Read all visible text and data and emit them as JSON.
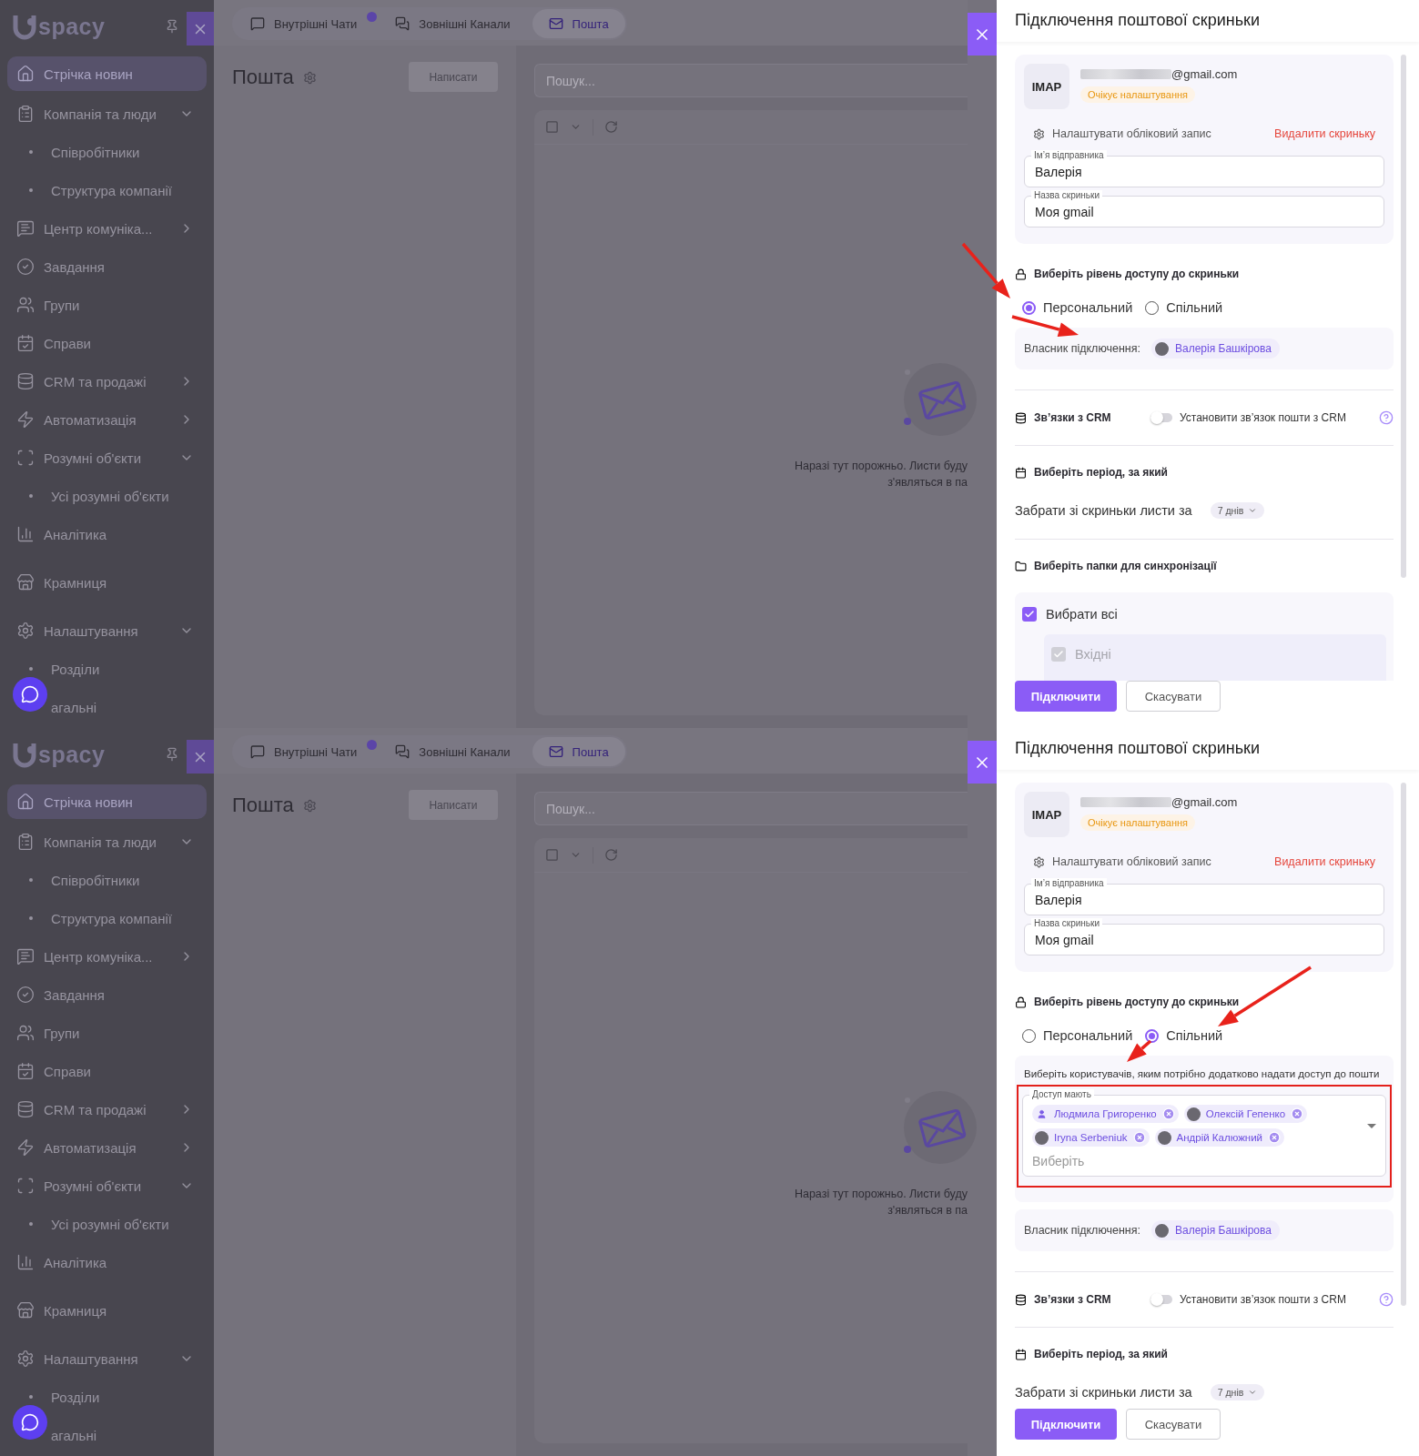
{
  "screens": [
    {
      "sidebar": {
        "logo": "spacy",
        "items": [
          {
            "label": "Стрічка новин",
            "kind": "section",
            "expandable": false,
            "expanded": false,
            "selected": true
          },
          {
            "label": "Компанія та люди",
            "kind": "section",
            "expandable": true,
            "expanded": true,
            "selected": false
          },
          {
            "label": "Співробітники",
            "kind": "sub",
            "expandable": false,
            "expanded": false,
            "selected": false
          },
          {
            "label": "Структура компанії",
            "kind": "sub",
            "expandable": false,
            "expanded": false,
            "selected": false
          },
          {
            "label": "Центр комуніка...",
            "kind": "section",
            "expandable": true,
            "expanded": false,
            "selected": false
          },
          {
            "label": "Завдання",
            "kind": "section",
            "expandable": false,
            "expanded": false,
            "selected": false
          },
          {
            "label": "Групи",
            "kind": "section",
            "expandable": false,
            "expanded": false,
            "selected": false
          },
          {
            "label": "Справи",
            "kind": "section",
            "expandable": false,
            "expanded": false,
            "selected": false
          },
          {
            "label": "CRM та продажі",
            "kind": "section",
            "expandable": true,
            "expanded": false,
            "selected": false
          },
          {
            "label": "Автоматизація",
            "kind": "section",
            "expandable": true,
            "expanded": false,
            "selected": false
          },
          {
            "label": "Розумні об'єкти",
            "kind": "section",
            "expandable": true,
            "expanded": true,
            "selected": false
          },
          {
            "label": "Усі розумні об'єкти",
            "kind": "sub",
            "expandable": false,
            "expanded": false,
            "selected": false
          },
          {
            "label": "Аналітика",
            "kind": "section",
            "expandable": false,
            "expanded": false,
            "selected": false
          },
          {
            "label": "Крамниця",
            "kind": "section",
            "expandable": false,
            "expanded": false,
            "selected": false
          },
          {
            "label": "Налаштування",
            "kind": "section",
            "expandable": true,
            "expanded": true,
            "selected": false
          },
          {
            "label": "Розділи",
            "kind": "sub",
            "expandable": false,
            "expanded": false,
            "selected": false
          },
          {
            "label": "агальні",
            "kind": "sub",
            "expandable": false,
            "expanded": false,
            "selected": false
          }
        ]
      },
      "tabs": [
        {
          "label": "Внутрішні Чати",
          "badge": true,
          "selected": false
        },
        {
          "label": "Зовнішні Канали",
          "badge": false,
          "selected": false
        },
        {
          "label": "Пошта",
          "badge": false,
          "selected": true
        }
      ],
      "mail": {
        "title": "Пошта",
        "compose": "Написати",
        "search_placeholder": "Пошук...",
        "empty_text": [
          "Наразі тут порожньо. Листи буду",
          "з'являться в па"
        ]
      },
      "drawer": {
        "title": "Підключення поштової скриньки",
        "account": {
          "protocol": "IMAP",
          "email": "@gmail.com",
          "status": "Очікує налаштування",
          "settings_link": "Налаштувати обліковий запис",
          "delete_link": "Видалити скриньку",
          "fields": [
            {
              "label": "Ім’я відправника",
              "value": "Валерія"
            },
            {
              "label": "Назва скриньки",
              "value": "Моя gmail"
            }
          ]
        },
        "access": {
          "title": "Виберіть рівень доступу до скриньки",
          "annotated": true,
          "options": [
            {
              "label": "Персональний",
              "selected": true
            },
            {
              "label": "Спільний",
              "selected": false
            }
          ],
          "owner_label": "Власник підключення:",
          "owner": "Валерія Башкірова"
        },
        "crm": {
          "title": "Зв’язки з CRM",
          "toggle_label": "Установити зв’язок пошти з CRM",
          "on": false
        },
        "period": {
          "title": "Виберіть період, за який",
          "label": "Забрати зі скриньки листи за",
          "value": "7 днів"
        },
        "folders": {
          "title": "Виберіть папки для синхронізації",
          "select_all": {
            "label": "Вибрати всі",
            "checked": true
          },
          "items": [
            {
              "label": "Вхідні",
              "checked": true,
              "disabled": true
            }
          ]
        },
        "buttons": {
          "primary": "Підключити",
          "secondary": "Скасувати"
        }
      }
    },
    {
      "sidebar": {
        "logo": "spacy",
        "items": [
          {
            "label": "Стрічка новин",
            "kind": "section",
            "expandable": false,
            "expanded": false,
            "selected": true
          },
          {
            "label": "Компанія та люди",
            "kind": "section",
            "expandable": true,
            "expanded": true,
            "selected": false
          },
          {
            "label": "Співробітники",
            "kind": "sub",
            "expandable": false,
            "expanded": false,
            "selected": false
          },
          {
            "label": "Структура компанії",
            "kind": "sub",
            "expandable": false,
            "expanded": false,
            "selected": false
          },
          {
            "label": "Центр комуніка...",
            "kind": "section",
            "expandable": true,
            "expanded": false,
            "selected": false
          },
          {
            "label": "Завдання",
            "kind": "section",
            "expandable": false,
            "expanded": false,
            "selected": false
          },
          {
            "label": "Групи",
            "kind": "section",
            "expandable": false,
            "expanded": false,
            "selected": false
          },
          {
            "label": "Справи",
            "kind": "section",
            "expandable": false,
            "expanded": false,
            "selected": false
          },
          {
            "label": "CRM та продажі",
            "kind": "section",
            "expandable": true,
            "expanded": false,
            "selected": false
          },
          {
            "label": "Автоматизація",
            "kind": "section",
            "expandable": true,
            "expanded": false,
            "selected": false
          },
          {
            "label": "Розумні об'єкти",
            "kind": "section",
            "expandable": true,
            "expanded": true,
            "selected": false
          },
          {
            "label": "Усі розумні об'єкти",
            "kind": "sub",
            "expandable": false,
            "expanded": false,
            "selected": false
          },
          {
            "label": "Аналітика",
            "kind": "section",
            "expandable": false,
            "expanded": false,
            "selected": false
          },
          {
            "label": "Крамниця",
            "kind": "section",
            "expandable": false,
            "expanded": false,
            "selected": false
          },
          {
            "label": "Налаштування",
            "kind": "section",
            "expandable": true,
            "expanded": true,
            "selected": false
          },
          {
            "label": "Розділи",
            "kind": "sub",
            "expandable": false,
            "expanded": false,
            "selected": false
          },
          {
            "label": "агальні",
            "kind": "sub",
            "expandable": false,
            "expanded": false,
            "selected": false
          }
        ]
      },
      "tabs": [
        {
          "label": "Внутрішні Чати",
          "badge": true,
          "selected": false
        },
        {
          "label": "Зовнішні Канали",
          "badge": false,
          "selected": false
        },
        {
          "label": "Пошта",
          "badge": false,
          "selected": true
        }
      ],
      "mail": {
        "title": "Пошта",
        "compose": "Написати",
        "search_placeholder": "Пошук...",
        "empty_text": [
          "Наразі тут порожньо. Листи буду",
          "з'являться в па"
        ]
      },
      "drawer": {
        "title": "Підключення поштової скриньки",
        "account": {
          "protocol": "IMAP",
          "email": "@gmail.com",
          "status": "Очікує налаштування",
          "settings_link": "Налаштувати обліковий запис",
          "delete_link": "Видалити скриньку",
          "fields": [
            {
              "label": "Ім’я відправника",
              "value": "Валерія"
            },
            {
              "label": "Назва скриньки",
              "value": "Моя gmail"
            }
          ]
        },
        "access": {
          "title": "Виберіть рівень доступу до скриньки",
          "annotated": true,
          "options": [
            {
              "label": "Персональний",
              "selected": false
            },
            {
              "label": "Спільний",
              "selected": true
            }
          ],
          "shared": {
            "hint": "Виберіть користувачів, яким потрібно додатково надати доступ до пошти",
            "label": "Доступ мають",
            "placeholder": "Виберіть",
            "users": [
              {
                "name": "Людмила Григоренко",
                "has_photo": false
              },
              {
                "name": "Олексій Гепенко",
                "has_photo": true
              },
              {
                "name": "Iryna Serbeniuk",
                "has_photo": true
              },
              {
                "name": "Андрій Калюжний",
                "has_photo": true
              }
            ]
          },
          "owner_label": "Власник підключення:",
          "owner": "Валерія Башкірова"
        },
        "crm": {
          "title": "Зв’язки з CRM",
          "toggle_label": "Установити зв’язок пошти з CRM",
          "on": false
        },
        "period": {
          "title": "Виберіть період, за який",
          "label": "Забрати зі скриньки листи за",
          "value": "7 днів"
        },
        "buttons": {
          "primary": "Підключити",
          "secondary": "Скасувати"
        }
      }
    }
  ]
}
